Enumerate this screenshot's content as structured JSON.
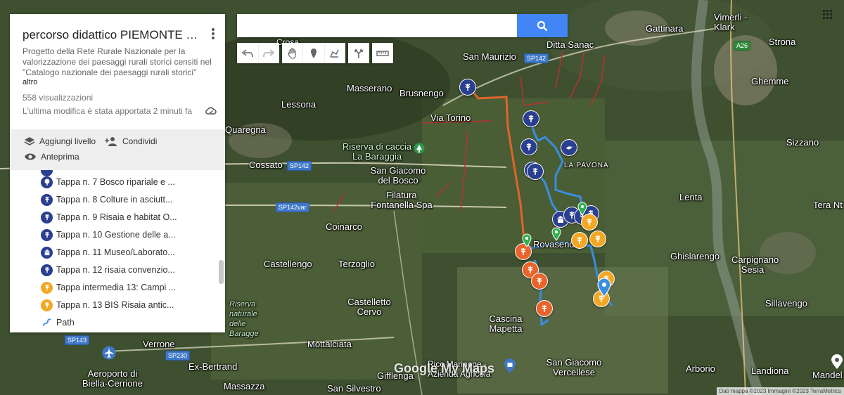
{
  "panel": {
    "title": "percorso didattico PIEMONTE Ba...",
    "description": "Progetto della Rete Rurale Nazionale per la valorizzazione dei paesaggi rurali storici censiti nel \"Catalogo nazionale dei paesaggi rurali storici\"",
    "more": "altro",
    "views": "558 visualizzazioni",
    "modified": "L'ultima modifica è stata apportata 2 minuti fa",
    "actions": {
      "add_layer": "Aggiungi livello",
      "share": "Condividi",
      "preview": "Anteprima"
    },
    "items": [
      {
        "label": "Tappa n. 7 Bosco ripariale e ...",
        "icon": "tree-icon",
        "color": "#2a3f8f"
      },
      {
        "label": "Tappa n. 8 Colture in asciutt...",
        "icon": "wheat-icon",
        "color": "#2a3f8f"
      },
      {
        "label": "Tappa n. 9 Risaia e habitat O...",
        "icon": "wheat-icon",
        "color": "#2a3f8f"
      },
      {
        "label": "Tappa n. 10 Gestione delle a...",
        "icon": "wheat-icon",
        "color": "#2a3f8f"
      },
      {
        "label": "Tappa n. 11 Museo/Laborato...",
        "icon": "museum-icon",
        "color": "#2a3f8f"
      },
      {
        "label": "Tappa n. 12 risaia convenzio...",
        "icon": "wheat-icon",
        "color": "#2a3f8f"
      },
      {
        "label": "Tappa intermedia 13: Campi ...",
        "icon": "wheat-icon",
        "color": "#f2a825"
      },
      {
        "label": "Tappa n. 13 BIS Risaia antic...",
        "icon": "wheat-icon",
        "color": "#f2a825"
      },
      {
        "label": "Path",
        "icon": "path-icon",
        "color": "#4285f4"
      }
    ]
  },
  "search": {
    "placeholder": "",
    "value": ""
  },
  "map": {
    "places": [
      "Vimerli - Klark",
      "Gattinara",
      "Strona",
      "Ghemme",
      "Sizzano",
      "Lenta",
      "Tera Nt",
      "Carpignano Sesia",
      "Ghislarengo",
      "Sillavengo",
      "Arborio",
      "Landiona",
      "Mandel",
      "San Maurizio",
      "Ditta Sanac",
      "Masserano",
      "Brusnengo",
      "Lessona",
      "Via Torino",
      "Quaregna",
      "Cossato",
      "Riserva di caccia La Baraggia",
      "San Giacomo del Bosco",
      "Filatura Fontanella Spa",
      "Coinarco",
      "Castellengo",
      "Terzoglio",
      "Castelletto Cervo",
      "Cascina Mapetta",
      "Mottalciata",
      "Gifflenga",
      "San Silvestro",
      "Massazza",
      "Ex-Bertrand",
      "Verrone",
      "Aeroporto di Biella-Cerrione",
      "San Giacomo Vercellese",
      "Ricc Marinone - Azienda Agricola",
      "Rovasenda",
      "LA PAVONA",
      "Crosa",
      "Riserva naturale delle Baragge"
    ],
    "roads": [
      "SP142",
      "SP142",
      "SP142var",
      "SP143",
      "SP230",
      "A26"
    ],
    "brand": "Google My Maps",
    "attribution": "Dati mappa ©2023 Immagini ©2023 TerraMetrics"
  },
  "colors": {
    "accent": "#4285f4",
    "navy_marker": "#2a3f8f",
    "orange_marker": "#e8642a",
    "yellow_marker": "#f2a825",
    "route_blue": "#3a8ee0",
    "route_orange": "#e0652a",
    "route_red": "#b83030"
  }
}
